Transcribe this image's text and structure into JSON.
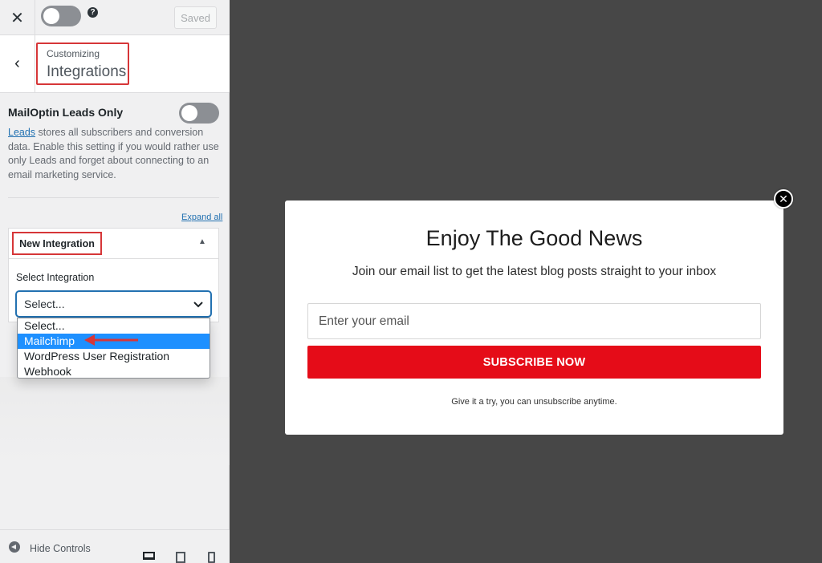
{
  "topbar": {
    "close_icon": "close-icon",
    "saved_label": "Saved",
    "help_icon": "?"
  },
  "section": {
    "subtitle": "Customizing",
    "title": "Integrations"
  },
  "leads": {
    "title": "MailOptin Leads Only",
    "link": "Leads",
    "description": " stores all subscribers and conversion data. Enable this setting if you would rather use only Leads and forget about connecting to an email marketing service."
  },
  "expand_all": "Expand all",
  "integration": {
    "header": "New Integration",
    "select_label": "Select Integration",
    "select_value": "Select...",
    "options": [
      "Select...",
      "Mailchimp",
      "WordPress User Registration",
      "Webhook"
    ],
    "selected_index": 1
  },
  "footer": {
    "hide_label": "Hide Controls"
  },
  "popup": {
    "title": "Enjoy The Good News",
    "subtitle": "Join our email list to get the latest blog posts straight to your inbox",
    "email_placeholder": "Enter your email",
    "button": "SUBSCRIBE NOW",
    "note": "Give it a try, you can unsubscribe anytime.",
    "close_icon": "✕"
  },
  "colors": {
    "accent_red": "#e50c18",
    "annotation_red": "#d63638",
    "link_blue": "#2271b1",
    "selected_blue": "#1e90ff"
  }
}
